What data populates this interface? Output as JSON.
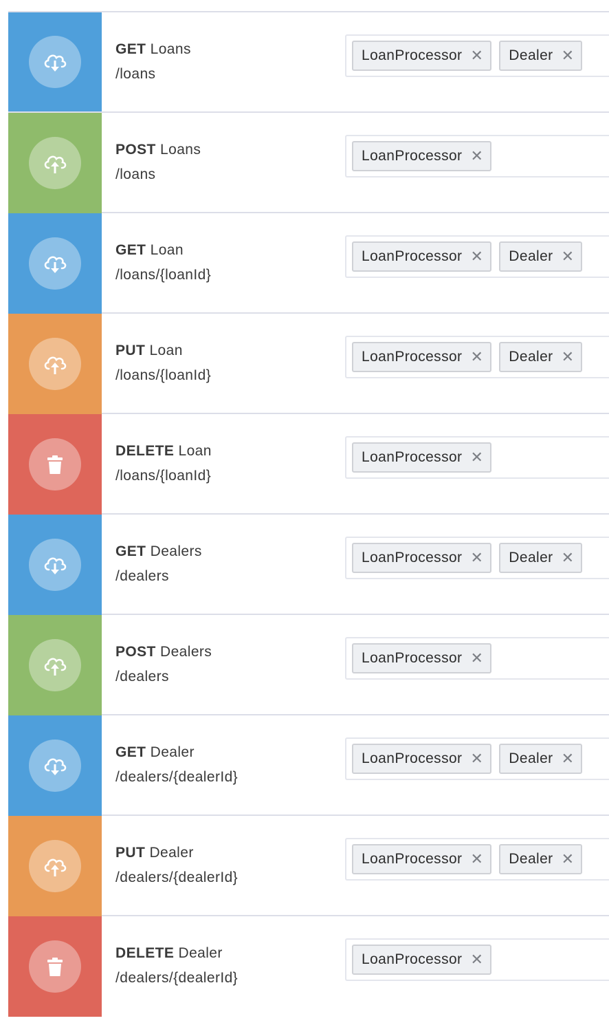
{
  "colors": {
    "get": "#4f9fdb",
    "post": "#8fbb6b",
    "put": "#e89a54",
    "delete": "#de665a"
  },
  "endpoints": [
    {
      "method": "GET",
      "name": "Loans",
      "path": "/loans",
      "icon": "cloud-download-icon",
      "roles": [
        "LoanProcessor",
        "Dealer"
      ]
    },
    {
      "method": "POST",
      "name": "Loans",
      "path": "/loans",
      "icon": "cloud-upload-icon",
      "roles": [
        "LoanProcessor"
      ]
    },
    {
      "method": "GET",
      "name": "Loan",
      "path": "/loans/{loanId}",
      "icon": "cloud-download-icon",
      "roles": [
        "LoanProcessor",
        "Dealer"
      ]
    },
    {
      "method": "PUT",
      "name": "Loan",
      "path": "/loans/{loanId}",
      "icon": "cloud-upload-icon",
      "roles": [
        "LoanProcessor",
        "Dealer"
      ]
    },
    {
      "method": "DELETE",
      "name": "Loan",
      "path": "/loans/{loanId}",
      "icon": "trash-icon",
      "roles": [
        "LoanProcessor"
      ]
    },
    {
      "method": "GET",
      "name": "Dealers",
      "path": "/dealers",
      "icon": "cloud-download-icon",
      "roles": [
        "LoanProcessor",
        "Dealer"
      ]
    },
    {
      "method": "POST",
      "name": "Dealers",
      "path": "/dealers",
      "icon": "cloud-upload-icon",
      "roles": [
        "LoanProcessor"
      ]
    },
    {
      "method": "GET",
      "name": "Dealer",
      "path": "/dealers/{dealerId}",
      "icon": "cloud-download-icon",
      "roles": [
        "LoanProcessor",
        "Dealer"
      ]
    },
    {
      "method": "PUT",
      "name": "Dealer",
      "path": "/dealers/{dealerId}",
      "icon": "cloud-upload-icon",
      "roles": [
        "LoanProcessor",
        "Dealer"
      ]
    },
    {
      "method": "DELETE",
      "name": "Dealer",
      "path": "/dealers/{dealerId}",
      "icon": "trash-icon",
      "roles": [
        "LoanProcessor"
      ]
    }
  ],
  "remove_glyph": "✕"
}
